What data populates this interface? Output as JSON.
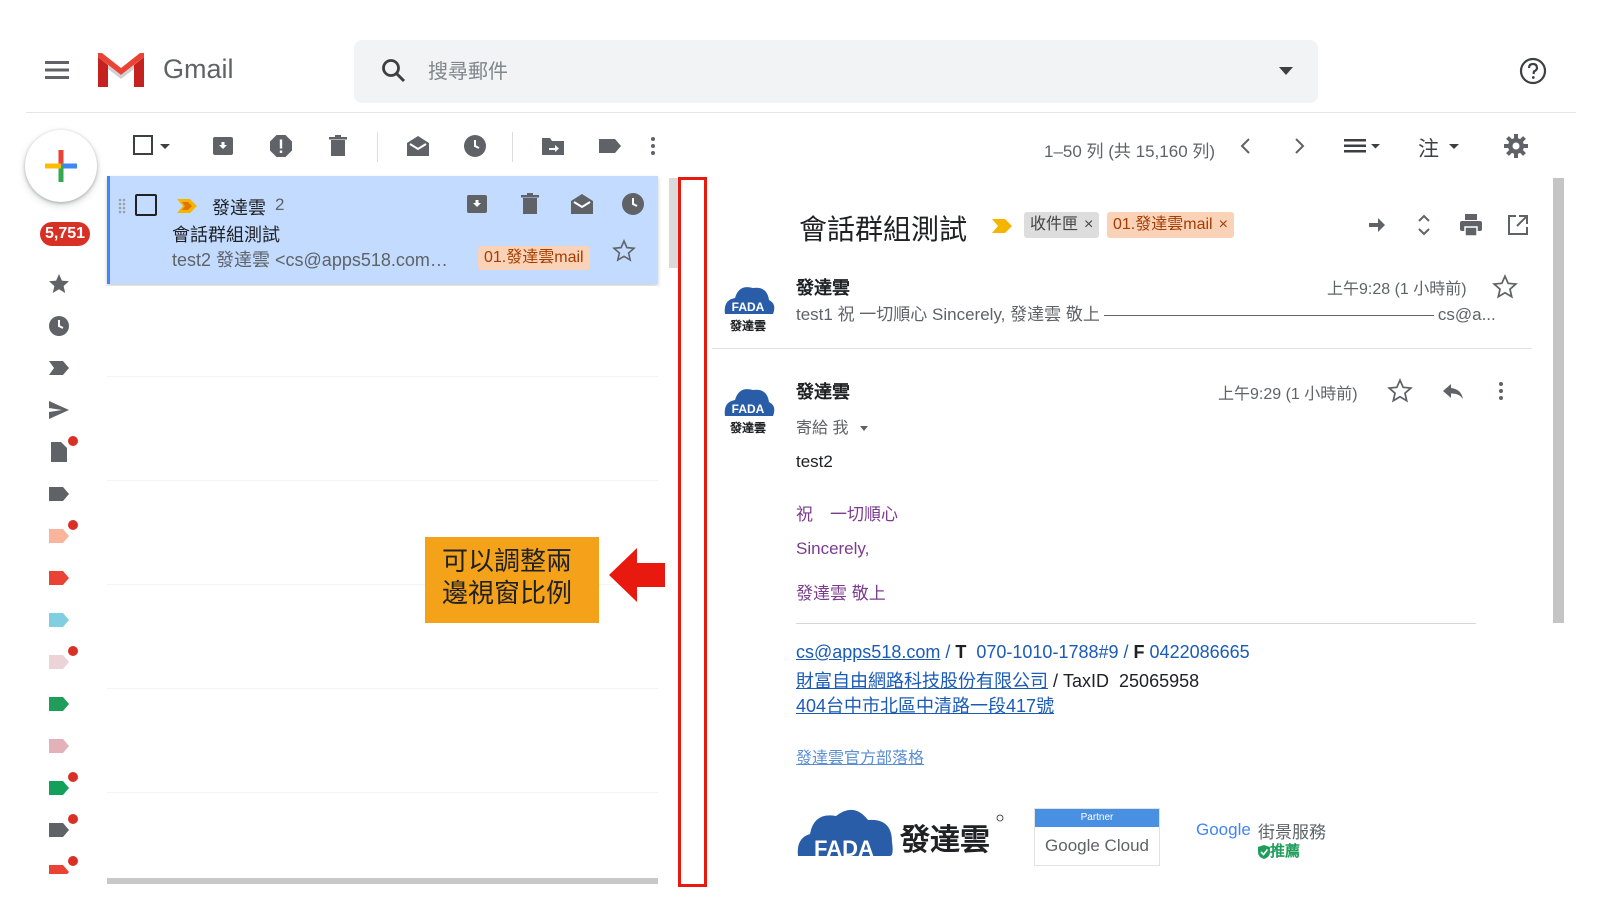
{
  "header": {
    "app_name": "Gmail",
    "search_placeholder": "搜尋郵件"
  },
  "nav": {
    "inbox_badge": "5,751",
    "icons": [
      "inbox-icon",
      "star-icon",
      "clock-icon",
      "important-icon",
      "send-icon",
      "draft-icon",
      "label-icon",
      "label-icon",
      "label-icon",
      "label-icon",
      "label-icon",
      "label-icon",
      "label-icon",
      "label-icon",
      "label-icon"
    ]
  },
  "toolbar": {
    "pager_text": "1–50 列 (共 15,160 列)",
    "input_tools_label": "注"
  },
  "thread": {
    "from": "發達雲",
    "count": "2",
    "subject": "會話群組測試",
    "snippet": "test2 發達雲 <cs@apps518.com…",
    "label": "01.發達雲mail"
  },
  "callout": {
    "line1": "可以調整兩",
    "line2": "邊視窗比例"
  },
  "reading": {
    "subject": "會話群組測試",
    "chip_inbox": "收件匣",
    "chip_label": "01.發達雲mail",
    "chip_close": "×",
    "message1": {
      "from": "發達雲",
      "time": "上午9:28 (1 小時前)",
      "snippet_start": "test1 祝 一切順心 Sincerely, 發達雲 敬上",
      "snippet_end": "cs@a..."
    },
    "message2": {
      "from": "發達雲",
      "time": "上午9:29 (1 小時前)",
      "to": "寄給 我",
      "body": "test2",
      "wish": "祝　一切順心",
      "sincerely": "Sincerely,",
      "signoff": "發達雲 敬上"
    },
    "signature": {
      "email": "cs@apps518.com",
      "slash1": " / ",
      "t_label": "T",
      "phone": "070-1010-1788#9",
      "slash2": " / ",
      "f_label": "F",
      "fax": "0422086665",
      "company": "財富自由網路科技股份有限公司",
      "taxid_label": " / TaxID ",
      "taxid": "25065958",
      "address": "404台中市北區中清路一段417號",
      "blog": "發達雲官方部落格",
      "brand_name": "發達雲",
      "brand_logo_text": "FADA",
      "partner_tag": "Partner",
      "google_cloud": "Google Cloud",
      "google": "Google",
      "street_view": "街景服務",
      "recommended": "推薦"
    }
  },
  "colors": {
    "accent_red": "#d93025",
    "selected_row": "#c2dbff",
    "label_bg": "#fad2b8",
    "callout_bg": "#f5a21b",
    "highlight_box": "#e8190f",
    "signature_purple": "#7b3c8f",
    "link_blue": "#1a5bb8"
  }
}
